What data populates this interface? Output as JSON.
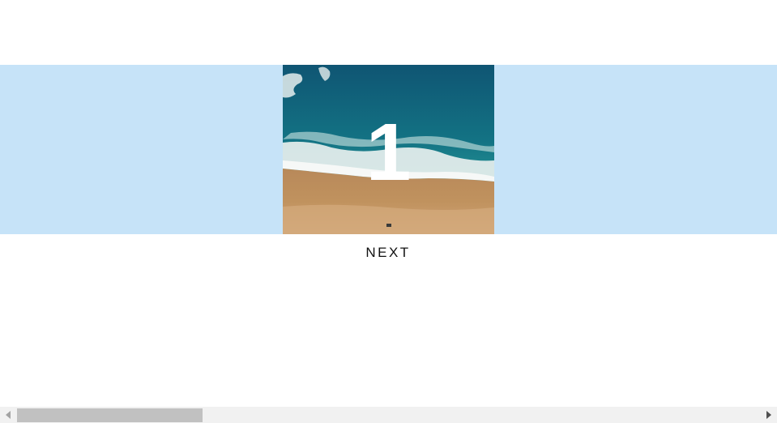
{
  "slider": {
    "current_slide_number": "1",
    "slide_image": "aerial-beach-waves-photo",
    "band_color": "#c6e3f8",
    "next_label": "NEXT"
  },
  "scrollbar": {
    "left_arrow_icon": "triangle-left-icon",
    "right_arrow_icon": "triangle-right-icon",
    "track_color": "#f1f1f1",
    "thumb_color": "#c1c1c1"
  }
}
